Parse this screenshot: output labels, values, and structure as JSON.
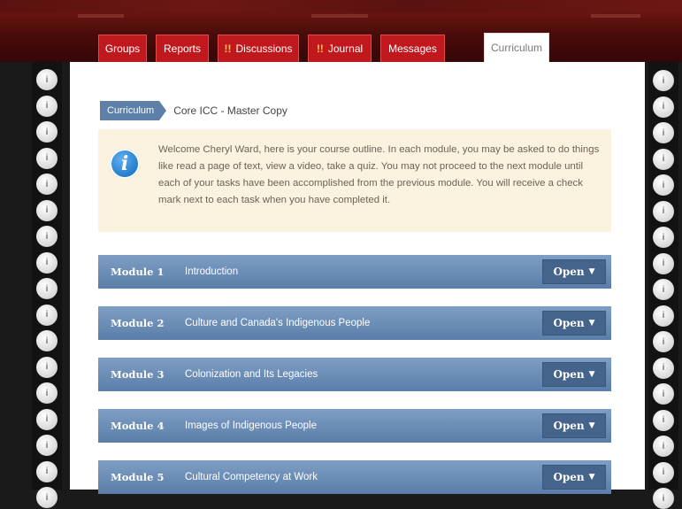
{
  "nav": {
    "tabs": [
      {
        "label": "Groups",
        "alert": ""
      },
      {
        "label": "Reports",
        "alert": ""
      },
      {
        "label": "Discussions",
        "alert": "!!"
      },
      {
        "label": "Journal",
        "alert": "!!"
      },
      {
        "label": "Messages",
        "alert": ""
      },
      {
        "label": "Curriculum",
        "alert": ""
      }
    ],
    "active_tab": "Curriculum"
  },
  "breadcrumb": {
    "section": "Curriculum",
    "current": "Core ICC - Master Copy"
  },
  "notice": {
    "icon": "info-icon",
    "text": "Welcome Cheryl Ward, here is your course outline. In each module, you may be asked to do things like read a page of text, view a video, take a quiz. You may not proceed to the next module until each of your tasks have been accomplished from the previous module. You will receive a check mark next to each task when you have completed it."
  },
  "modules": [
    {
      "number": "Module 1",
      "title": "Introduction",
      "button": "Open",
      "button_icon": "caret-down-icon"
    },
    {
      "number": "Module 2",
      "title": "Culture and Canada's Indigenous People",
      "button": "Open",
      "button_icon": "caret-down-icon"
    },
    {
      "number": "Module 3",
      "title": "Colonization and Its Legacies",
      "button": "Open",
      "button_icon": "caret-down-icon"
    },
    {
      "number": "Module 4",
      "title": "Images of Indigenous People",
      "button": "Open",
      "button_icon": "caret-down-icon"
    },
    {
      "number": "Module 5",
      "title": "Cultural Competency at Work",
      "button": "Open",
      "button_icon": "caret-down-icon"
    }
  ],
  "film_strip": {
    "hole_glyph": "i"
  },
  "colors": {
    "header": "#4a0c0a",
    "tab": "#c0191d",
    "alert": "#ffd23c",
    "module_bar": "#5a7ea9",
    "open_button": "#45648c",
    "notice_bg": "#fbf2e0",
    "info_icon": "#1f78c8"
  }
}
